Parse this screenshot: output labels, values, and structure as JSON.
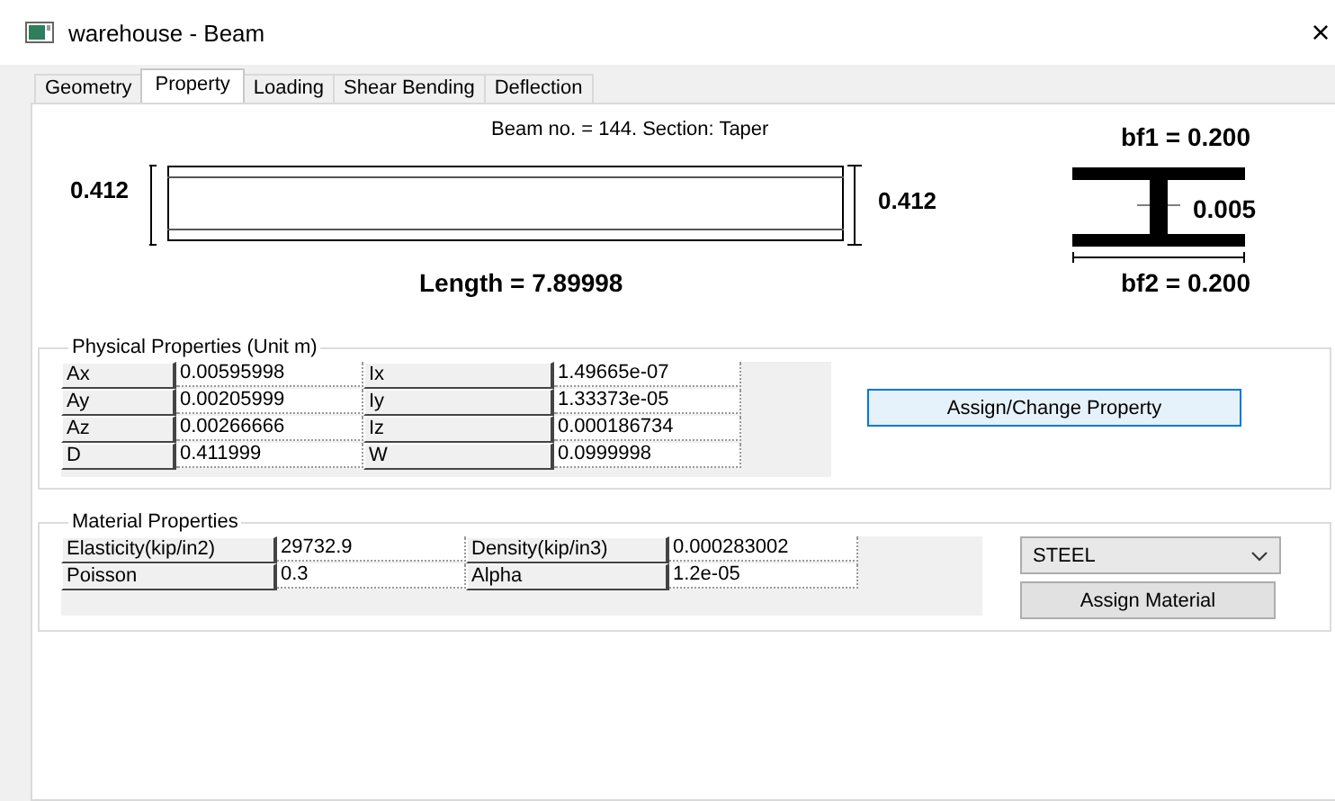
{
  "window": {
    "title": "warehouse - Beam",
    "close": "×"
  },
  "tabs": [
    {
      "label": "Geometry",
      "selected": false
    },
    {
      "label": "Property",
      "selected": true
    },
    {
      "label": "Loading",
      "selected": false
    },
    {
      "label": "Shear Bending",
      "selected": false
    },
    {
      "label": "Deflection",
      "selected": false
    }
  ],
  "diagram": {
    "caption": "Beam no. = 144. Section: Taper",
    "left_depth": "0.412",
    "right_depth": "0.412",
    "length": "Length = 7.89998",
    "bf1": "bf1 = 0.200",
    "web": "0.005",
    "bf2": "bf2 = 0.200"
  },
  "physical": {
    "title": "Physical Properties (Unit m)",
    "rows": [
      [
        "Ax",
        "0.00595998",
        "Ix",
        "1.49665e-07"
      ],
      [
        "Ay",
        "0.00205999",
        "Iy",
        "1.33373e-05"
      ],
      [
        "Az",
        "0.00266666",
        "Iz",
        "0.000186734"
      ],
      [
        "D",
        "0.411999",
        "W",
        "0.0999998"
      ]
    ]
  },
  "assign_property_button": "Assign/Change Property",
  "material": {
    "title": "Material Properties",
    "rows": [
      [
        "Elasticity(kip/in2)",
        "29732.9",
        "Density(kip/in3)",
        "0.000283002"
      ],
      [
        "Poisson",
        "0.3",
        "Alpha",
        "1.2e-05"
      ]
    ]
  },
  "material_dropdown": {
    "value": "STEEL"
  },
  "assign_material_button": "Assign Material"
}
